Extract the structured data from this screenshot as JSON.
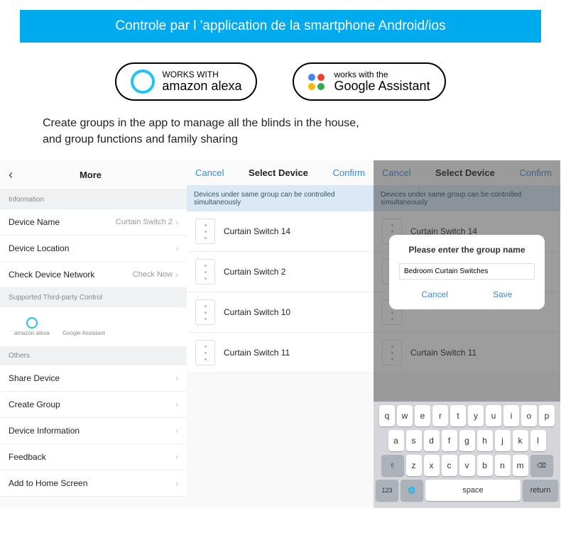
{
  "banner": "Controle par l 'application de la smartphone Android/ios",
  "badges": {
    "alexa_top": "WORKS WITH",
    "alexa_bot": "amazon alexa",
    "google_top": "works with the",
    "google_bot": "Google Assistant"
  },
  "description": "Create groups in the app to manage all the blinds in the house, and group functions and family sharing",
  "screen1": {
    "back": "‹",
    "title": "More",
    "sect_info": "Information",
    "rows": {
      "device_name": {
        "label": "Device Name",
        "value": "Curtain Switch 2"
      },
      "device_location": {
        "label": "Device Location",
        "value": ""
      },
      "check_network": {
        "label": "Check Device Network",
        "value": "Check Now"
      }
    },
    "sect_third": "Supported Third-party Control",
    "third": {
      "alexa": "amazon alexa",
      "google": "Google Assistant"
    },
    "sect_others": "Others",
    "others": [
      "Share Device",
      "Create Group",
      "Device Information",
      "Feedback",
      "Add to Home Screen"
    ]
  },
  "screen2": {
    "cancel": "Cancel",
    "title": "Select Device",
    "confirm": "Confirm",
    "info": "Devices under same group can be controlled simultaneously",
    "devices": [
      "Curtain Switch 14",
      "Curtain Switch 2",
      "Curtain Switch 10",
      "Curtain Switch 11"
    ]
  },
  "screen3": {
    "cancel": "Cancel",
    "title": "Select Device",
    "confirm": "Confirm",
    "info": "Devices under same group can be controlled simultaneously",
    "devices": [
      "Curtain Switch 14",
      "",
      "",
      "Curtain Switch 11"
    ],
    "dialog": {
      "title": "Please enter the group name",
      "input": "Bedroom Curtain Switches",
      "cancel": "Cancel",
      "save": "Save"
    },
    "kb": {
      "r1": [
        "q",
        "w",
        "e",
        "r",
        "t",
        "y",
        "u",
        "i",
        "o",
        "p"
      ],
      "r2": [
        "a",
        "s",
        "d",
        "f",
        "g",
        "h",
        "j",
        "k",
        "l"
      ],
      "r3": [
        "z",
        "x",
        "c",
        "v",
        "b",
        "n",
        "m"
      ],
      "shift": "⇧",
      "del": "⌫",
      "num": "123",
      "globe": "🌐",
      "space": "space",
      "return": "return"
    }
  }
}
